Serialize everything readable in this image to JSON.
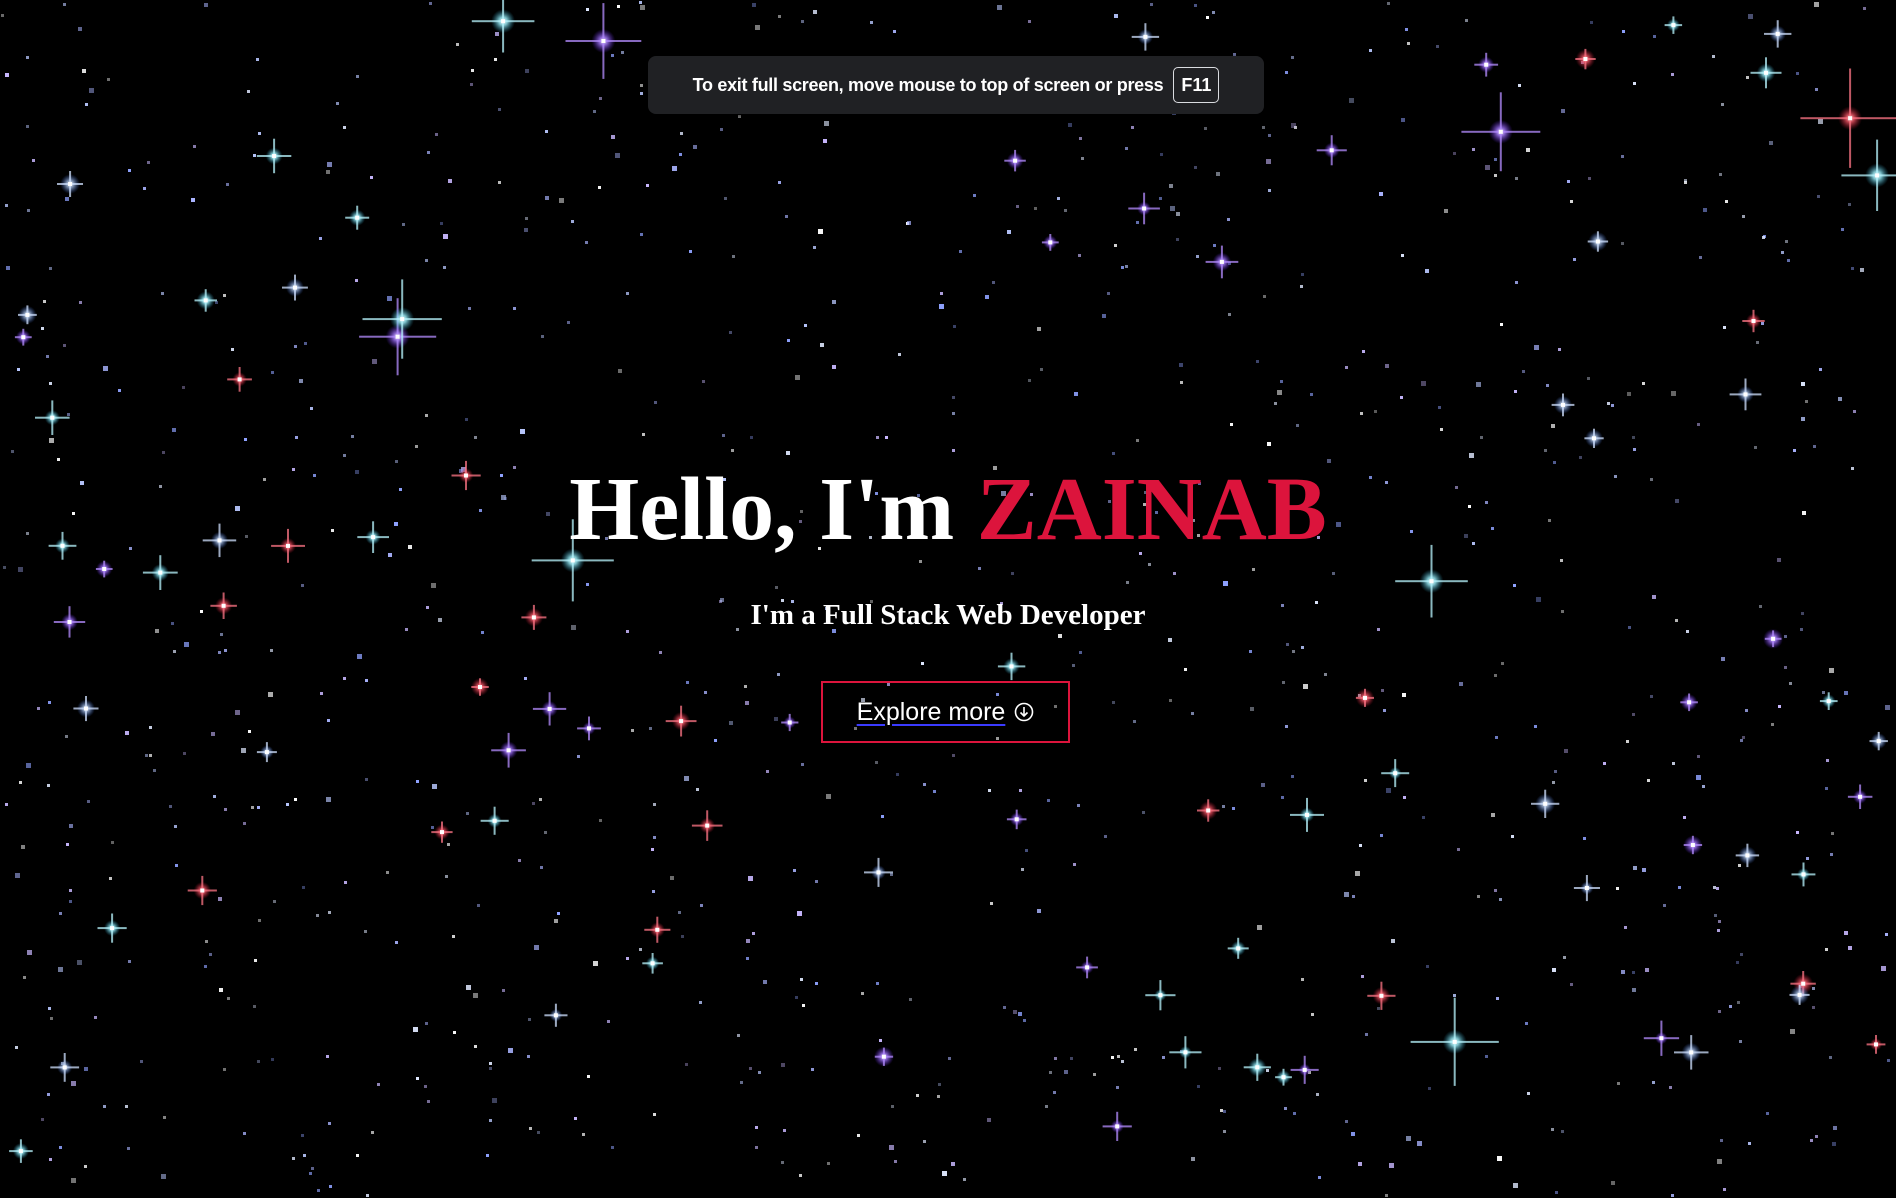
{
  "fullscreen_notice": {
    "text": "To exit full screen, move mouse to top of screen or press",
    "key": "F11"
  },
  "hero": {
    "greeting": "Hello, I'm",
    "name": "ZAINAB",
    "subtitle": "I'm a Full Stack Web Developer",
    "cta_label": "Explore more",
    "cta_icon": "arrow-down-circle-icon"
  },
  "colors": {
    "background": "#000000",
    "accent": "#dc143c",
    "text": "#ffffff",
    "toast_bg": "#202124"
  }
}
